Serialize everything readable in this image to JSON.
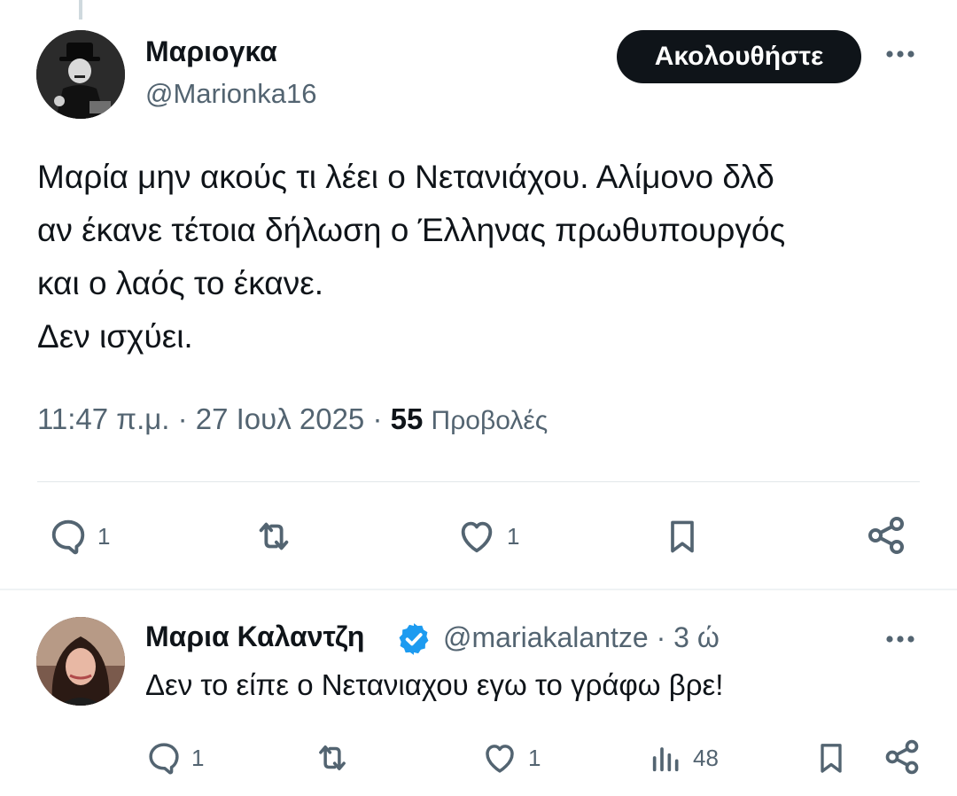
{
  "tweet": {
    "author_name": "Μαριογκα",
    "author_handle": "@Marionka16",
    "follow_label": "Ακολουθήστε",
    "text_lines": [
      "Μαρία μην ακούς τι λέει ο Νετανιάχου. Αλίμονο δλδ",
      "αν έκανε τέτοια δήλωση ο Έλληνας πρωθυπουργός",
      "και ο λαός το έκανε.",
      "Δεν ισχύει."
    ],
    "time": "11:47 π.μ.",
    "separator": "·",
    "date": "27 Ιουλ 2025",
    "views_count": "55",
    "views_label": "Προβολές",
    "actions": {
      "reply_count": "1",
      "like_count": "1"
    },
    "icons": [
      "reply-icon",
      "retweet-icon",
      "like-icon",
      "bookmark-icon",
      "share-icon",
      "more-icon"
    ]
  },
  "reply": {
    "author_name": "Μαρια Καλαντζη",
    "verified_icon": "verified-badge-icon",
    "author_handle": "@mariakalantze",
    "separator": "·",
    "age": "3 ώ",
    "text": "Δεν το είπε ο Νετανιαχου εγω το γράφω βρε!",
    "actions": {
      "reply_count": "1",
      "like_count": "1",
      "views_count": "48"
    }
  },
  "colors": {
    "text_primary": "#0f1419",
    "text_secondary": "#536471",
    "follow_button_bg": "#0f1419",
    "verified_blue": "#1d9bf0",
    "divider": "#e2e7ea"
  }
}
